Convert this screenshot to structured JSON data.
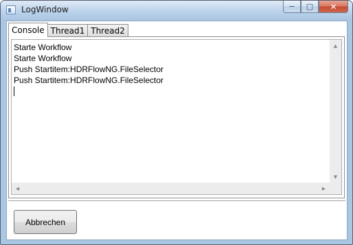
{
  "window": {
    "title": "LogWindow",
    "controls": {
      "minimize": "−",
      "maximize": "□",
      "close": "✕"
    }
  },
  "tabs": [
    {
      "label": "Console",
      "active": true
    },
    {
      "label": "Thread1",
      "active": false
    },
    {
      "label": "Thread2",
      "active": false
    }
  ],
  "console": {
    "lines": [
      "Starte Workflow",
      "Starte Workflow",
      "Push Startitem:HDRFlowNG.FileSelector",
      "Push Startitem:HDRFlowNG.FileSelector"
    ]
  },
  "scrollbar": {
    "up": "▲",
    "down": "▼",
    "left": "◀",
    "right": "▶"
  },
  "buttons": {
    "cancel": "Abbrechen"
  },
  "icons": {
    "app": "window-app-icon",
    "minimize": "minimize-icon",
    "maximize": "maximize-icon",
    "close": "close-icon"
  }
}
